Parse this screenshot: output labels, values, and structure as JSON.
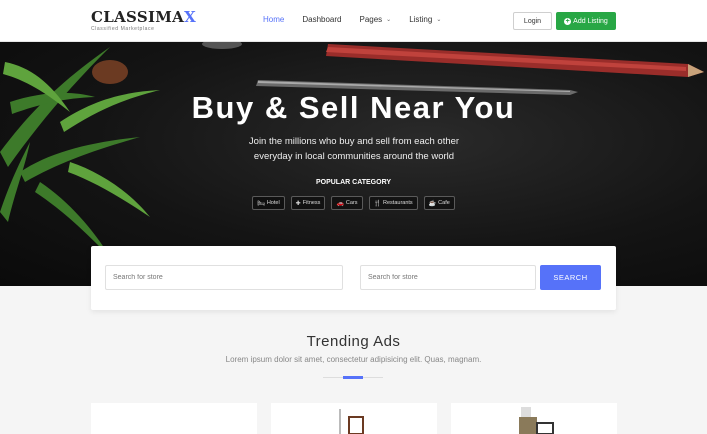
{
  "brand": {
    "name_main": "CLASSIMA",
    "name_accent": "X",
    "tagline": "Classified Marketplace"
  },
  "nav": {
    "home": "Home",
    "dashboard": "Dashboard",
    "pages": "Pages",
    "listing": "Listing"
  },
  "header_actions": {
    "login": "Login",
    "add_listing": "Add Listing"
  },
  "hero": {
    "title": "Buy & Sell Near You",
    "subtitle": "Join the millions who buy and sell from each other everyday in local communities around the world",
    "popular_title": "POPULAR CATEGORY",
    "categories": [
      {
        "label": "Hotel",
        "icon": "bed-icon",
        "glyph": "🛏"
      },
      {
        "label": "Fitness",
        "icon": "fitness-icon",
        "glyph": "✚"
      },
      {
        "label": "Cars",
        "icon": "car-icon",
        "glyph": "🚗"
      },
      {
        "label": "Restaurants",
        "icon": "utensils-icon",
        "glyph": "🍴"
      },
      {
        "label": "Cafe",
        "icon": "coffee-icon",
        "glyph": "☕"
      }
    ]
  },
  "search": {
    "store_placeholder_1": "Search for store",
    "store_placeholder_2": "Search for store",
    "button": "SEARCH"
  },
  "trending": {
    "title": "Trending Ads",
    "subtitle": "Lorem ipsum dolor sit amet, consectetur adipisicing elit. Quas, magnam."
  },
  "colors": {
    "accent": "#5672f9",
    "success": "#28a745"
  }
}
